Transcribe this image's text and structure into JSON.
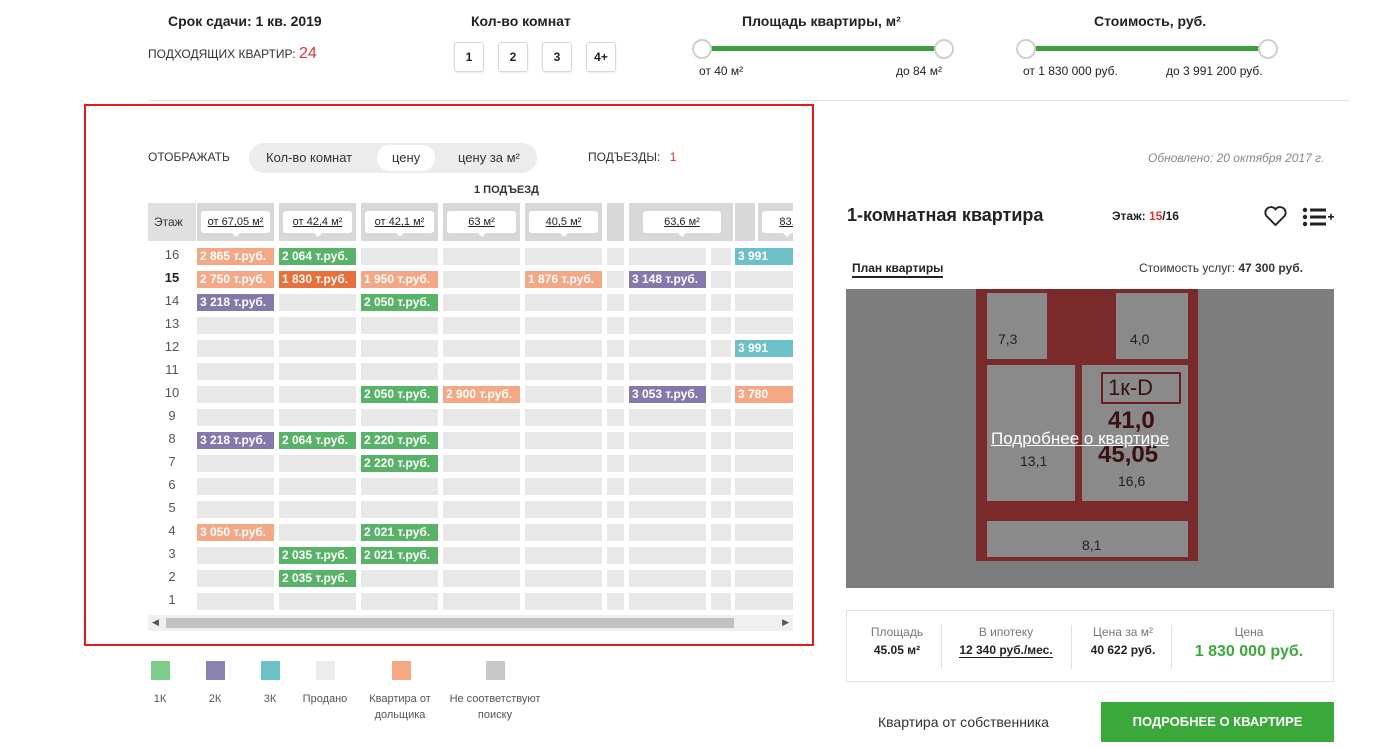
{
  "header": {
    "deadline": "Срок сдачи: 1 кв. 2019",
    "matching_label": "ПОДХОДЯЩИХ КВАРТИР:",
    "matching_count": "24",
    "rooms_title": "Кол-во комнат",
    "rooms": [
      "1",
      "2",
      "3",
      "4+"
    ],
    "area_title": "Площадь квартиры, м²",
    "area_from": "от 40 м²",
    "area_to": "до 84 м²",
    "price_title": "Стоимость, руб.",
    "price_from": "от 1 830 000 руб.",
    "price_to": "до 3 991 200 руб."
  },
  "display": {
    "label": "ОТОБРАЖАТЬ",
    "options": [
      "Кол-во комнат",
      "цену",
      "цену за м²"
    ],
    "selected": "цену",
    "entrances_label": "ПОДЪЕЗДЫ:",
    "entrances_value": "1",
    "entrance_title": "1 ПОДЪЕЗД",
    "floor_col": "Этаж"
  },
  "columns": [
    "от 67,05 м²",
    "от 42,4 м²",
    "от 42,1 м²",
    "63 м²",
    "40,5 м²",
    "63,6 м²",
    "83,"
  ],
  "floors": [
    "16",
    "15",
    "14",
    "13",
    "12",
    "11",
    "10",
    "9",
    "8",
    "7",
    "6",
    "5",
    "4",
    "3",
    "2",
    "1"
  ],
  "current_floor": "15",
  "cells": {
    "16": {
      "0": [
        "2 865 т.руб.",
        "dev"
      ],
      "1": [
        "2 064 т.руб.",
        "k1"
      ],
      "8": [
        "3 991",
        "k3"
      ]
    },
    "15": {
      "0": [
        "2 750 т.руб.",
        "dev"
      ],
      "1": [
        "1 830 т.руб.",
        "active"
      ],
      "2": [
        "1 950 т.руб.",
        "dev"
      ],
      "4": [
        "1 876 т.руб.",
        "dev"
      ],
      "5": [
        "3 148 т.руб.",
        "k2"
      ]
    },
    "14": {
      "0": [
        "3 218 т.руб.",
        "k2"
      ],
      "2": [
        "2 050 т.руб.",
        "k1"
      ]
    },
    "12": {
      "8": [
        "3 991",
        "k3"
      ]
    },
    "10": {
      "2": [
        "2 050 т.руб.",
        "k1"
      ],
      "3": [
        "2 900 т.руб.",
        "dev"
      ],
      "5": [
        "3 053 т.руб.",
        "k2"
      ],
      "8": [
        "3 780",
        "dev"
      ]
    },
    "8": {
      "0": [
        "3 218 т.руб.",
        "k2"
      ],
      "1": [
        "2 064 т.руб.",
        "k1"
      ],
      "2": [
        "2 220 т.руб.",
        "k1"
      ]
    },
    "7": {
      "2": [
        "2 220 т.руб.",
        "k1"
      ]
    },
    "4": {
      "0": [
        "3 050 т.руб.",
        "dev"
      ],
      "2": [
        "2 021 т.руб.",
        "k1"
      ]
    },
    "3": {
      "1": [
        "2 035 т.руб.",
        "k1"
      ],
      "2": [
        "2 021 т.руб.",
        "k1"
      ]
    },
    "2": {
      "1": [
        "2 035 т.руб.",
        "k1"
      ]
    }
  },
  "colors": {
    "k1": "#58b368",
    "k2": "#8479aa",
    "k3": "#6cc0c8",
    "dev": "#f4a886",
    "active": "#e8703a",
    "sold": "#e8e8e8",
    "nomatch": "#c8c8c8"
  },
  "legend": [
    {
      "label": "1К",
      "color": "#7fcc8a"
    },
    {
      "label": "2К",
      "color": "#8a82b2"
    },
    {
      "label": "3К",
      "color": "#6cc0c8"
    },
    {
      "label": "Продано",
      "color": "#ececec"
    },
    {
      "label": "Квартира от дольщика",
      "color": "#f4a886"
    },
    {
      "label": "Не соответствуют поиску",
      "color": "#c8c8c8"
    }
  ],
  "updated": "Обновлено: 20 октября 2017 г.",
  "apartment": {
    "title": "1-комнатная квартира",
    "floor_label": "Этаж:",
    "floor_current": "15",
    "floor_total": "/16",
    "plan_tab": "План квартиры",
    "service_label": "Стоимость услуг:",
    "service_value": "47 300 руб.",
    "plan_link": "Подробнее о квартире",
    "plan_labels": {
      "r1": "7,3",
      "r2": "4,0",
      "code": "1к-D",
      "a1": "41,0",
      "a2": "45,05",
      "r3": "13,1",
      "r4": "16,6",
      "r5": "8,1"
    },
    "area_label": "Площадь",
    "area_value": "45.05 м²",
    "mortgage_label": "В ипотеку",
    "mortgage_value": "12 340 руб./мес.",
    "ppm_label": "Цена за м²",
    "ppm_value": "40 622 руб.",
    "price_label": "Цена",
    "price_value": "1 830 000 руб.",
    "owner_text": "Квартира от собственника",
    "details_button": "ПОДРОБНЕЕ О КВАРТИРЕ"
  }
}
